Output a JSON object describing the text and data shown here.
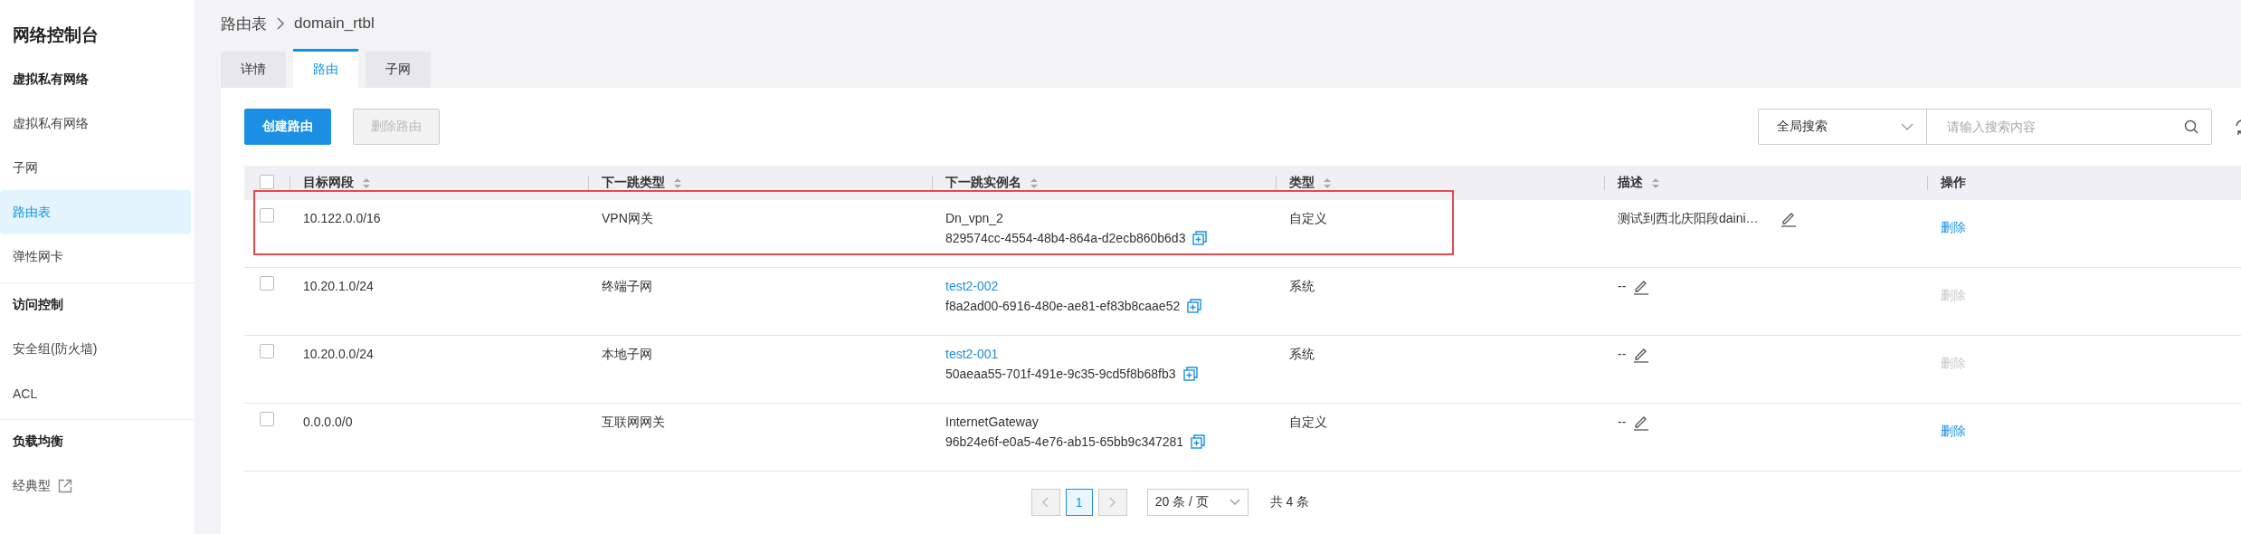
{
  "sidebar": {
    "title": "网络控制台",
    "sections": [
      {
        "heading": "虚拟私有网络",
        "items": [
          {
            "label": "虚拟私有网络",
            "selected": false,
            "external": false
          },
          {
            "label": "子网",
            "selected": false,
            "external": false
          },
          {
            "label": "路由表",
            "selected": true,
            "external": false
          },
          {
            "label": "弹性网卡",
            "selected": false,
            "external": false
          }
        ]
      },
      {
        "heading": "访问控制",
        "items": [
          {
            "label": "安全组(防火墙)",
            "selected": false,
            "external": false
          },
          {
            "label": "ACL",
            "selected": false,
            "external": false
          }
        ]
      },
      {
        "heading": "负载均衡",
        "items": [
          {
            "label": "经典型",
            "selected": false,
            "external": true
          }
        ]
      }
    ]
  },
  "breadcrumb": [
    "路由表",
    "domain_rtbl"
  ],
  "tabs": [
    {
      "label": "详情",
      "selected": false
    },
    {
      "label": "路由",
      "selected": true
    },
    {
      "label": "子网",
      "selected": false
    }
  ],
  "buttons": [
    {
      "label": "创建路由",
      "disabled": false
    },
    {
      "label": "删除路由",
      "disabled": true
    }
  ],
  "search": {
    "scope": "全局搜索",
    "placeholder": "请输入搜索内容"
  },
  "table": {
    "all_checked": false,
    "columns": [
      {
        "label": "目标网段",
        "sortable": true
      },
      {
        "label": "下一跳类型",
        "sortable": true
      },
      {
        "label": "下一跳实例名",
        "sortable": true
      },
      {
        "label": "类型",
        "sortable": true
      },
      {
        "label": "描述",
        "sortable": true
      },
      {
        "label": "操作",
        "sortable": false
      }
    ],
    "rows": [
      {
        "checked": false,
        "highlighted": true,
        "destination": "10.122.0.0/16",
        "next_hop_type": "VPN网关",
        "instance_name": "Dn_vpn_2",
        "instance_link": false,
        "instance_id": "829574cc-4554-48b4-864a-d2ecb860b6d3",
        "type": "自定义",
        "description": "测试到西北庆阳段daini…",
        "action": "删除",
        "action_disabled": false
      },
      {
        "checked": false,
        "highlighted": false,
        "destination": "10.20.1.0/24",
        "next_hop_type": "终端子网",
        "instance_name": "test2-002",
        "instance_link": true,
        "instance_id": "f8a2ad00-6916-480e-ae81-ef83b8caae52",
        "type": "系统",
        "description": "--",
        "action": "删除",
        "action_disabled": true
      },
      {
        "checked": false,
        "highlighted": false,
        "destination": "10.20.0.0/24",
        "next_hop_type": "本地子网",
        "instance_name": "test2-001",
        "instance_link": true,
        "instance_id": "50aeaa55-701f-491e-9c35-9cd5f8b68fb3",
        "type": "系统",
        "description": "--",
        "action": "删除",
        "action_disabled": true
      },
      {
        "checked": false,
        "highlighted": false,
        "destination": "0.0.0.0/0",
        "next_hop_type": "互联网网关",
        "instance_name": "InternetGateway",
        "instance_link": false,
        "instance_id": "96b24e6f-e0a5-4e76-ab15-65bb9c347281",
        "type": "自定义",
        "description": "--",
        "action": "删除",
        "action_disabled": false
      }
    ]
  },
  "pagination": {
    "pages": [
      {
        "label": "1",
        "selected": true
      }
    ],
    "page_size": "20 条 / 页",
    "total": "共 4 条"
  }
}
